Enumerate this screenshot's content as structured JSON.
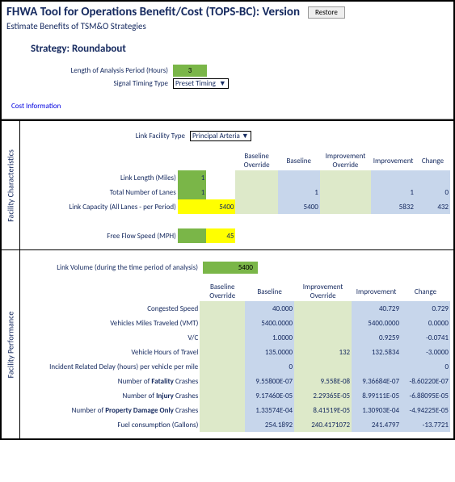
{
  "header": {
    "title": "FHWA Tool for Operations Benefit/Cost (TOPS-BC):  Version",
    "restore_label": "Restore",
    "subtitle": "Estimate Benefits of TSM&O Strategies"
  },
  "strategy": {
    "title": "Strategy: Roundabout",
    "length_label": "Length of Analysis Period (Hours)",
    "length_value": "3",
    "timing_label": "Signal Timing Type",
    "timing_value": "Preset Timing"
  },
  "cost_link": "Cost Information",
  "facility_char": {
    "vlabel": "Facility Characteristics",
    "facility_type_label": "Link Facility Type",
    "facility_type_value": "Principal Arteria",
    "cols": {
      "bov": "Baseline Override",
      "bas": "Baseline",
      "iov": "Improvement Override",
      "imp": "Improvement",
      "chg": "Change"
    },
    "rows": {
      "link_length": {
        "label": "Link Length (Miles)",
        "in": "1"
      },
      "lanes": {
        "label": "Total Number of Lanes",
        "in": "1",
        "bas": "1",
        "imp": "1",
        "chg": "0"
      },
      "capacity": {
        "label": "Link Capacity (All Lanes - per Period)",
        "val": "5400",
        "bas": "5400",
        "imp": "5832",
        "chg": "432"
      },
      "ffs": {
        "label": "Free Flow Speed (MPH)",
        "val": "45"
      }
    }
  },
  "facility_perf": {
    "vlabel": "Facility Performance",
    "link_volume_label": "Link Volume (during the time period of analysis)",
    "link_volume_value": "5400",
    "cols": {
      "bov": "Baseline Override",
      "bas": "Baseline",
      "iov": "Improvement Override",
      "imp": "Improvement",
      "chg": "Change"
    },
    "rows": [
      {
        "label": "Congested Speed",
        "bas": "40.000",
        "imp": "40.729",
        "chg": "0.729"
      },
      {
        "label": "Vehicles Miles Traveled (VMT)",
        "bas": "5400.0000",
        "imp": "5400.0000",
        "chg": "0.0000"
      },
      {
        "label": "V/C",
        "bas": "1.0000",
        "imp": "0.9259",
        "chg": "-0.0741"
      },
      {
        "label": "Vehicle Hours of Travel",
        "bas": "135.0000",
        "iov": "132",
        "imp": "132.5834",
        "chg": "-3.0000"
      },
      {
        "label": "Incident Related Delay (hours) per vehicle per mile",
        "bas": "0",
        "imp": "",
        "chg": "0"
      },
      {
        "label": "Number of Fatality Crashes",
        "bold": "Fatality",
        "bas": "9.55800E-07",
        "iov": "9.558E-08",
        "imp": "9.36684E-07",
        "chg": "-8.60220E-07"
      },
      {
        "label": "Number of Injury Crashes",
        "bold": "Injury",
        "bas": "9.17460E-05",
        "iov": "2.29365E-05",
        "imp": "8.99111E-05",
        "chg": "-6.88095E-05"
      },
      {
        "label": "Number of Property Damage Only Crashes",
        "bold": "Property Damage Only",
        "bas": "1.33574E-04",
        "iov": "8.41519E-05",
        "imp": "1.30903E-04",
        "chg": "-4.94225E-05"
      },
      {
        "label": "Fuel consumption (Gallons)",
        "bas": "254.1892",
        "iov": "240.4171072",
        "imp": "241.4797",
        "chg": "-13.7721"
      }
    ]
  }
}
